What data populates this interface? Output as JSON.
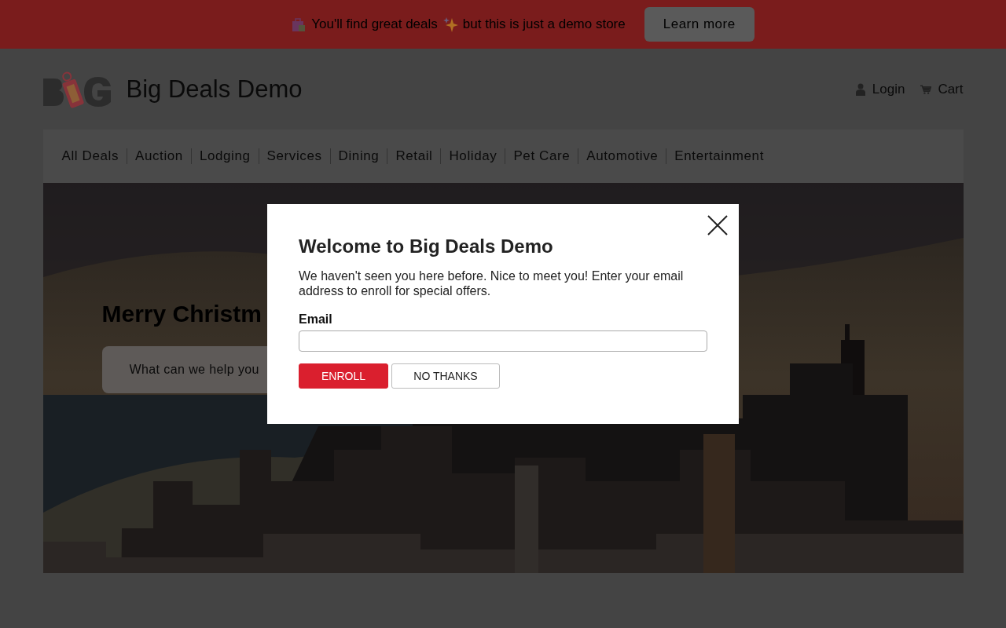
{
  "promo_banner": {
    "text_before": "You'll find great deals",
    "text_after": "but this is just a demo store",
    "button": "Learn more"
  },
  "header": {
    "site_title": "Big Deals Demo",
    "links": [
      "Login",
      "Cart"
    ]
  },
  "nav": [
    "All Deals",
    "Auction",
    "Lodging",
    "Services",
    "Dining",
    "Retail",
    "Holiday",
    "Pet Care",
    "Automotive",
    "Entertainment"
  ],
  "hero": {
    "heading": "Merry Christm",
    "search": {
      "placeholder": "What can we help you"
    }
  },
  "modal": {
    "title": "Welcome to Big Deals Demo",
    "message": "We haven't seen you here before. Nice to meet you! Enter your email address to enroll for special offers.",
    "email_label": "Email",
    "buttons": [
      "ENROLL",
      "NO THANKS"
    ]
  }
}
